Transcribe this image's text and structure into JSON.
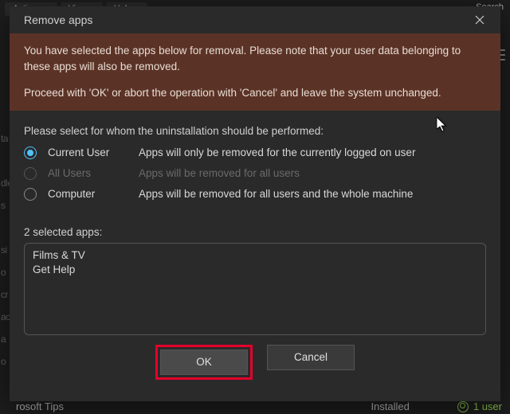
{
  "bg": {
    "menu": [
      "Actions",
      "View",
      "Help"
    ],
    "search": "Search",
    "left_frag": "ta\n\ndle\ns\n\nsi\no\ncr\nac\na\no",
    "bottom_app": "rosoft Tips",
    "bottom_status": "Installed",
    "bottom_users": "1 user"
  },
  "dialog": {
    "title": "Remove apps",
    "warn1": "You have selected the apps below for removal. Please note that your user data belonging to these apps will also be removed.",
    "warn2": "Proceed with 'OK' or abort the operation with 'Cancel' and leave the system unchanged.",
    "prompt": "Please select for whom the uninstallation should be performed:",
    "options": [
      {
        "label": "Current User",
        "desc": "Apps will only be removed for the currently logged on user",
        "selected": true,
        "disabled": false
      },
      {
        "label": "All Users",
        "desc": "Apps will be removed for all users",
        "selected": false,
        "disabled": true
      },
      {
        "label": "Computer",
        "desc": "Apps will be removed for all users and the whole machine",
        "selected": false,
        "disabled": false
      }
    ],
    "selected_count_label": "2 selected apps:",
    "apps": [
      "Films & TV",
      "Get Help"
    ],
    "ok": "OK",
    "cancel": "Cancel"
  }
}
